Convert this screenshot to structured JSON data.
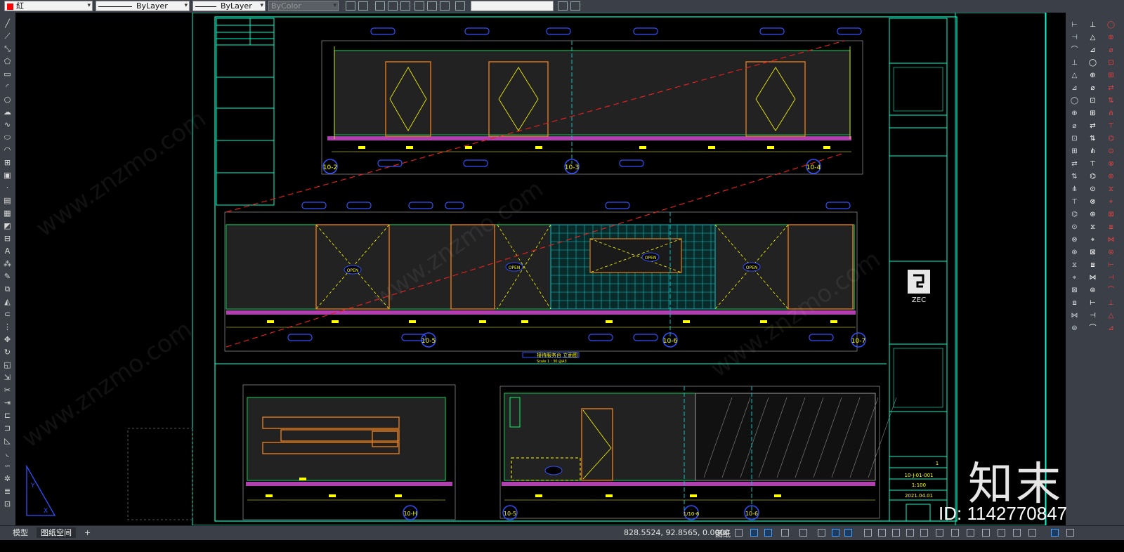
{
  "toolbar": {
    "layer_name": "紅",
    "layer_color": "#ff0000",
    "linetype": "ByLayer",
    "lineweight": "ByLayer",
    "plotstyle": "ByColor"
  },
  "drawing": {
    "elev_top_labels": [
      "10-2",
      "10-3",
      "10-4"
    ],
    "elev_mid_labels": [
      "10-5",
      "10-6",
      "10-7"
    ],
    "open_label": "OPEN",
    "section_title": "接待服务台 立面图",
    "section_scale": "Scale 1 : 30 @A3",
    "bottom_labels": [
      "10-H",
      "10-5",
      "1/10-6",
      "10-6"
    ],
    "title_block_logo": "ZEC",
    "tb_rows": [
      "1:100",
      "10-J-01-001",
      "2021.04.01"
    ],
    "tb_sheet_no": "1"
  },
  "statusbar": {
    "tab_model": "模型",
    "tab_layout": "图纸空间",
    "tab_add": "+",
    "coordinates": "828.5524, 92.8565, 0.0000",
    "space": "图纸"
  },
  "watermark": {
    "brand": "知末",
    "id_text": "ID: 1142770847",
    "site": "www.znzmo.com"
  },
  "colors": {
    "ui_bg": "#3b4048",
    "canvas": "#000000",
    "frame": "#00ffcc",
    "yellow": "#ffff00",
    "orange": "#e07b1e",
    "magenta": "#b040b0",
    "red_dash": "#e02020",
    "blue_tag": "#3050ff",
    "cyan": "#00c8c8"
  }
}
